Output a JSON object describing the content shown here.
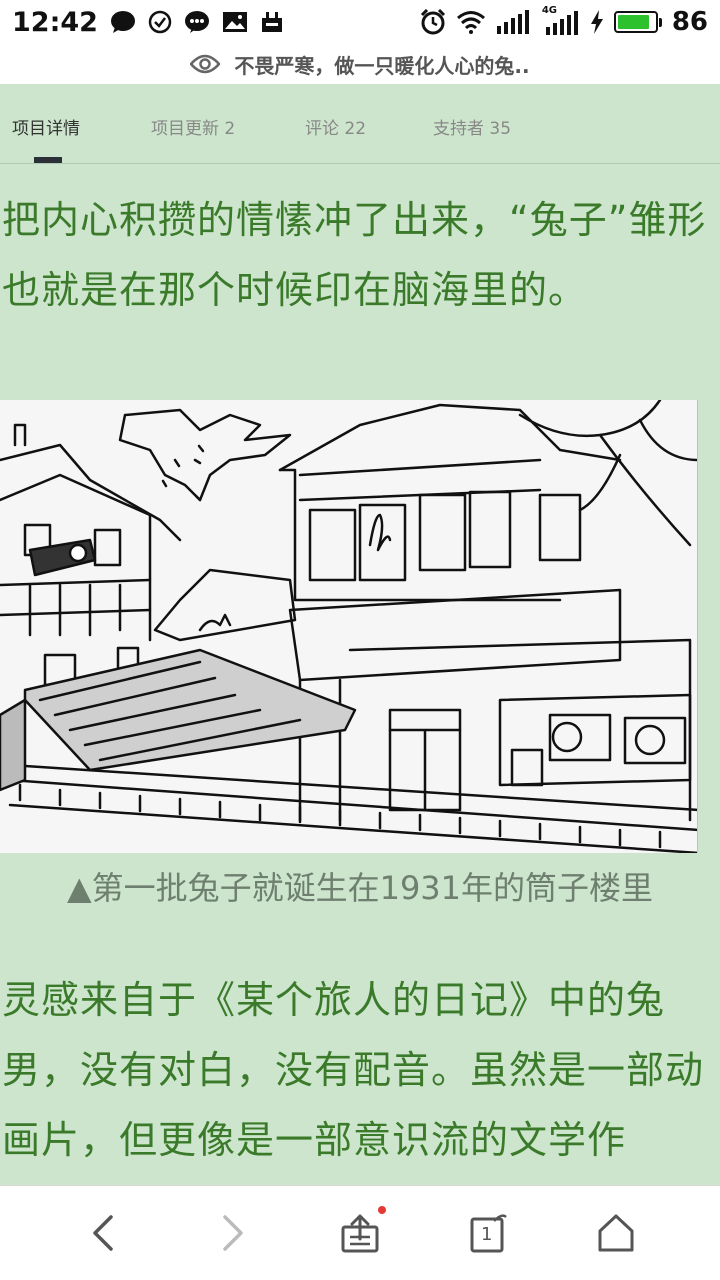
{
  "status_bar": {
    "time": "12:42",
    "battery_percent": "86",
    "battery_level": 0.86,
    "network_label": "4G",
    "icons": [
      "chat-bubble-icon",
      "check-circle-icon",
      "messenger-icon",
      "image-icon",
      "sim-card-icon",
      "alarm-clock-icon",
      "wifi-icon",
      "signal-icon",
      "signal-4g-icon",
      "charging-icon",
      "battery-icon"
    ]
  },
  "title_bar": {
    "icon": "eye-icon",
    "title": "不畏严寒，做一只暖化人心的兔.."
  },
  "tabs": [
    {
      "label": "项目详情",
      "active": true
    },
    {
      "label": "项目更新 2",
      "active": false
    },
    {
      "label": "评论 22",
      "active": false
    },
    {
      "label": "支持者 35",
      "active": false
    }
  ],
  "article": {
    "paragraph_1": "把内心积攒的情愫冲了出来，“兔子”雏形也就是在那个时候印在脑海里的。",
    "image_caption": "▲第一批兔子就诞生在1931年的筒子楼里",
    "paragraph_2": "灵感来自于《某个旅人的日记》中的兔男，没有对白，没有配音。虽然是一部动画片，但更像是一部意识流的文学作"
  },
  "bottom_nav": {
    "icons": [
      "back-icon",
      "forward-icon",
      "share-icon",
      "tabs-icon",
      "home-icon"
    ],
    "tab_count": "1",
    "share_has_badge": true
  },
  "colors": {
    "background": "#cce5cc",
    "text_green": "#3a7a2a",
    "caption_gray": "#6f7f6f",
    "tab_indicator": "#2b3038",
    "battery_green": "#2ec12e",
    "badge_red": "#e53935"
  }
}
